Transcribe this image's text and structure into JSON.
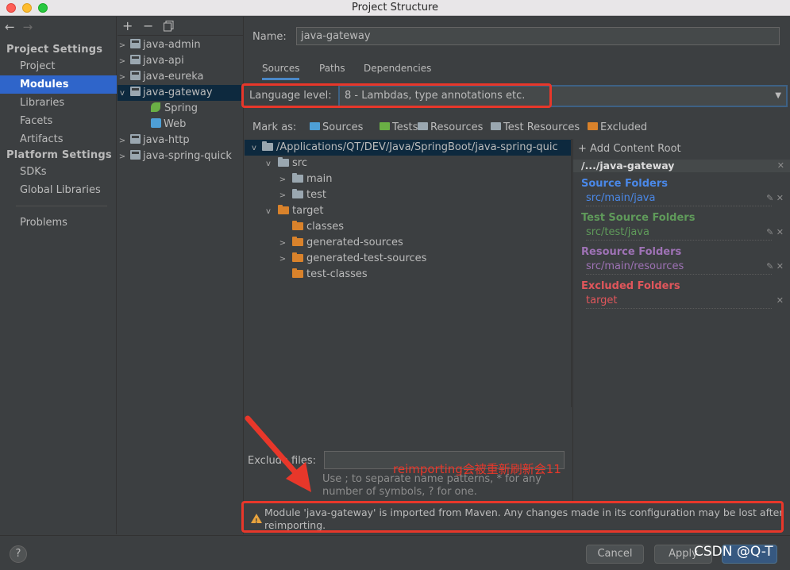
{
  "window": {
    "title": "Project Structure"
  },
  "nav": {
    "back_icon": "arrow-left-icon",
    "forward_icon": "arrow-right-icon",
    "project_settings_header": "Project Settings",
    "project_settings_items": [
      "Project",
      "Modules",
      "Libraries",
      "Facets",
      "Artifacts"
    ],
    "platform_settings_header": "Platform Settings",
    "platform_settings_items": [
      "SDKs",
      "Global Libraries"
    ],
    "other_items": [
      "Problems"
    ],
    "selected": "Modules"
  },
  "modules_toolbar": {
    "add": "+",
    "remove": "−",
    "copy_icon": "copy-icon"
  },
  "modules": [
    {
      "label": "java-admin",
      "expandable": true
    },
    {
      "label": "java-api",
      "expandable": true
    },
    {
      "label": "java-eureka",
      "expandable": true
    },
    {
      "label": "java-gateway",
      "expandable": true,
      "expanded": true,
      "selected": true
    },
    {
      "label": "Spring",
      "child": true,
      "icon": "spring-icon"
    },
    {
      "label": "Web",
      "child": true,
      "icon": "web-icon"
    },
    {
      "label": "java-http",
      "expandable": true
    },
    {
      "label": "java-spring-quick",
      "expandable": true
    }
  ],
  "main": {
    "name_label": "Name:",
    "name_value": "java-gateway",
    "tabs": [
      "Sources",
      "Paths",
      "Dependencies"
    ],
    "active_tab": "Sources",
    "language_level_label": "Language level:",
    "language_level_value": "8 - Lambdas, type annotations etc.",
    "mark_as_label": "Mark as:",
    "mark_as": [
      {
        "label": "Sources",
        "color": "#4e9fd6"
      },
      {
        "label": "Tests",
        "color": "#6aaf45"
      },
      {
        "label": "Resources",
        "color": "#9aa7b0"
      },
      {
        "label": "Test Resources",
        "color": "#9aa7b0"
      },
      {
        "label": "Excluded",
        "color": "#d9822b"
      }
    ],
    "tree": [
      {
        "label": "/Applications/QT/DEV/Java/SpringBoot/java-spring-quic",
        "depth": 0,
        "chev": "v",
        "color": "gray",
        "selected": true
      },
      {
        "label": "src",
        "depth": 1,
        "chev": "v",
        "color": "gray"
      },
      {
        "label": "main",
        "depth": 2,
        "chev": ">",
        "color": "gray"
      },
      {
        "label": "test",
        "depth": 2,
        "chev": ">",
        "color": "gray"
      },
      {
        "label": "target",
        "depth": 1,
        "chev": "v",
        "color": "orange"
      },
      {
        "label": "classes",
        "depth": 2,
        "chev": "",
        "color": "orange"
      },
      {
        "label": "generated-sources",
        "depth": 2,
        "chev": ">",
        "color": "orange"
      },
      {
        "label": "generated-test-sources",
        "depth": 2,
        "chev": ">",
        "color": "orange"
      },
      {
        "label": "test-classes",
        "depth": 2,
        "chev": "",
        "color": "orange"
      }
    ],
    "content_roots": {
      "add_label": "Add Content Root",
      "root": "/.../java-gateway",
      "groups": [
        {
          "title": "Source Folders",
          "path": "src/main/java",
          "color": "#4a88e8",
          "path_color": "#4a88e8"
        },
        {
          "title": "Test Source Folders",
          "path": "src/test/java",
          "color": "#5f9a5a",
          "path_color": "#5f9a5a"
        },
        {
          "title": "Resource Folders",
          "path": "src/main/resources",
          "color": "#9e72b5",
          "path_color": "#9e72b5"
        },
        {
          "title": "Excluded Folders",
          "path": "target",
          "color": "#e0565b",
          "path_color": "#e0565b"
        }
      ]
    },
    "exclude_label": "Exclude files:",
    "exclude_hint": "Use ; to separate name patterns, * for any number of symbols, ? for one.",
    "annotation_text": "reimporting会被重新刷新会11",
    "warning": "Module 'java-gateway' is imported from Maven. Any changes made in its configuration may be lost after reimporting."
  },
  "footer": {
    "help": "?",
    "cancel": "Cancel",
    "apply": "Apply",
    "watermark": "CSDN @Q-T"
  }
}
